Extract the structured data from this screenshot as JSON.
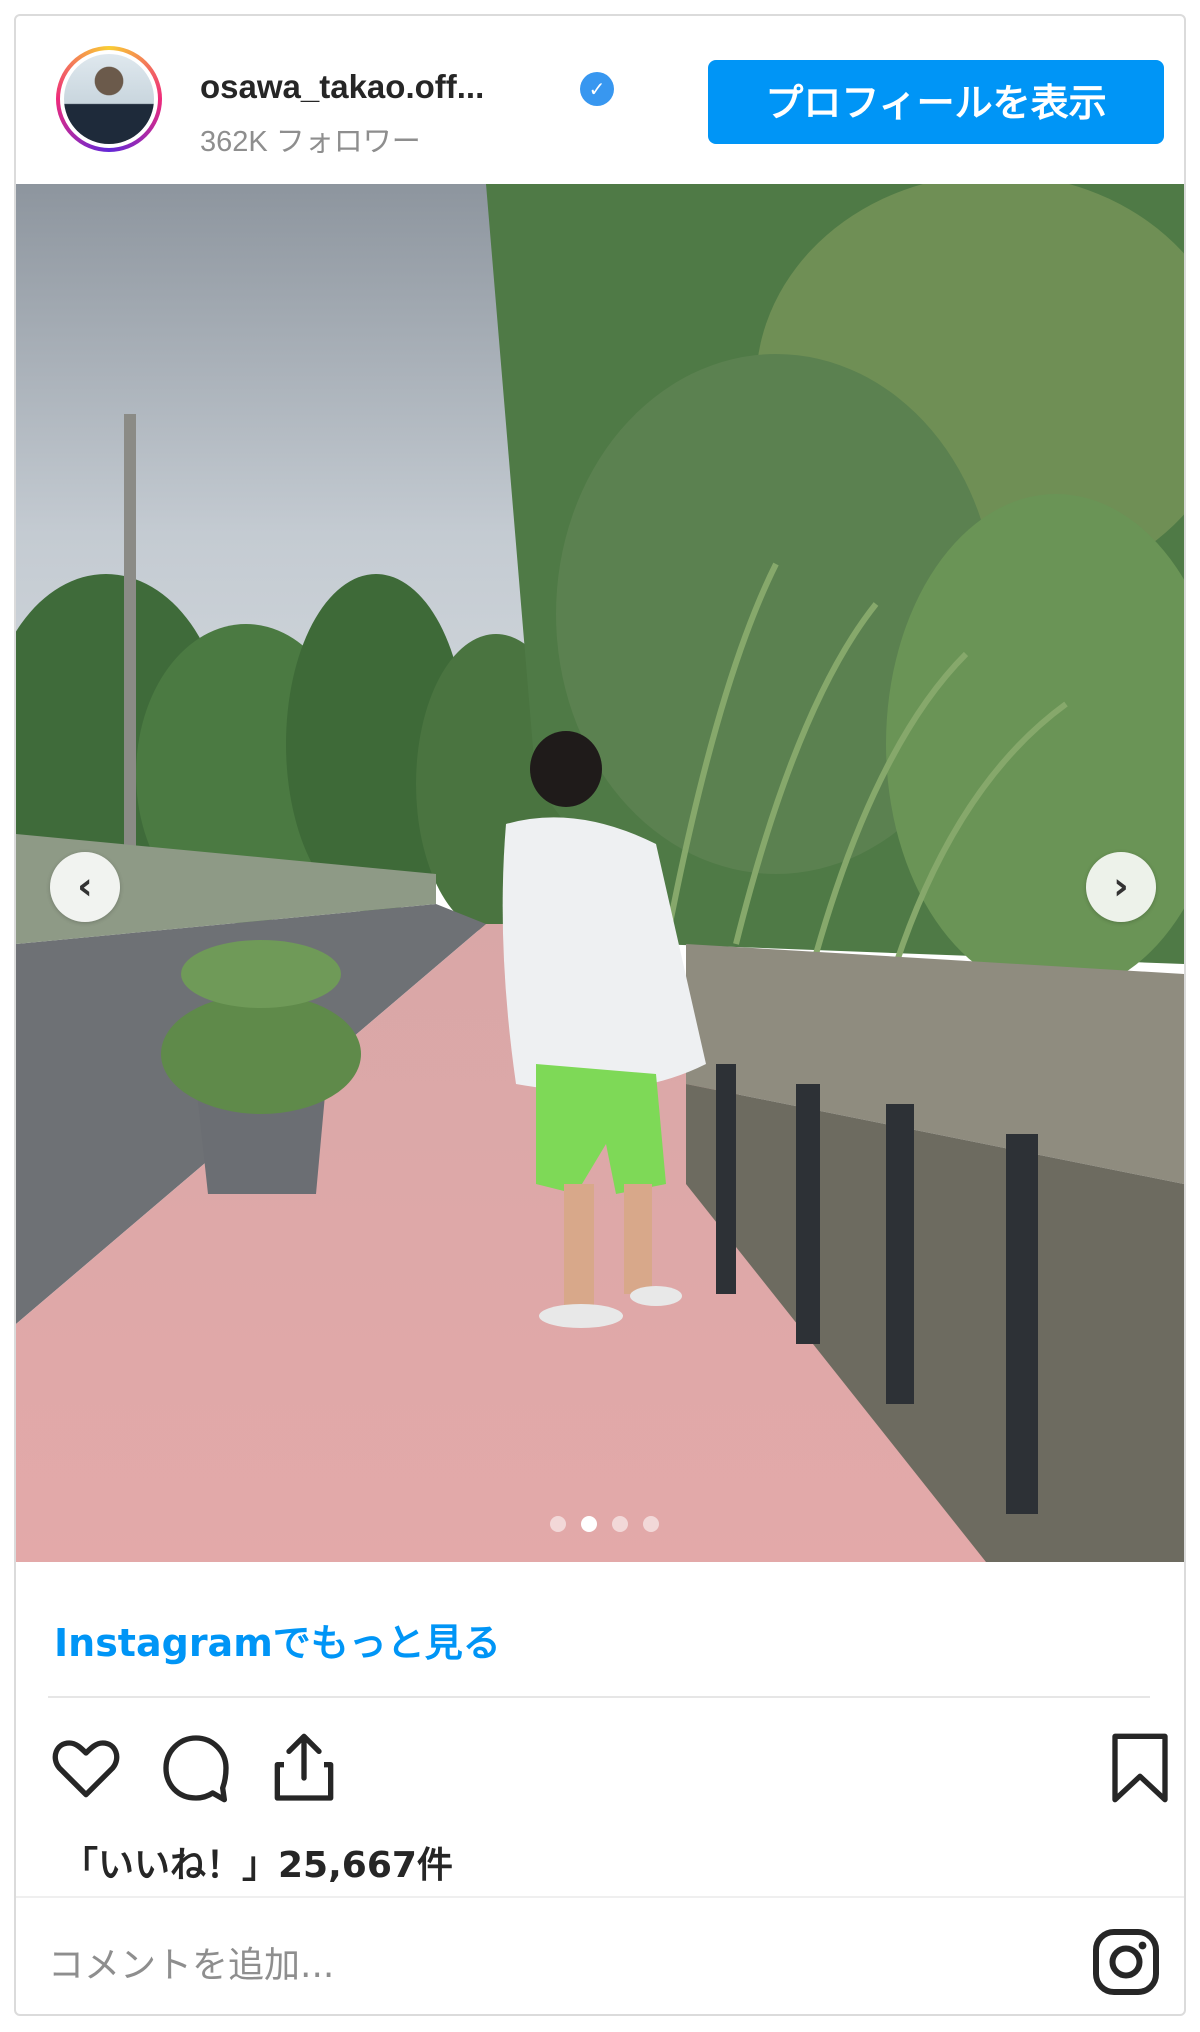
{
  "post": {
    "username": "osawa_takao.off...",
    "verified_icon": "verified-badge-icon",
    "followers": "362K フォロワー",
    "profile_button": "プロフィールを表示",
    "prev_arrow": "‹",
    "next_arrow": "›",
    "carousel": {
      "total_slides": 4,
      "active_slide": 2
    },
    "more_link": "Instagramでもっと見る",
    "likes": "「いいね！」25,667件",
    "comment_placeholder": "コメントを追加...",
    "icons": {
      "heart": "heart-icon",
      "comment": "comment-icon",
      "share": "share-icon",
      "bookmark": "bookmark-icon",
      "instagram": "instagram-logo-icon"
    }
  },
  "colors": {
    "accent": "#0095f6",
    "text": "#262626",
    "muted": "#8e8e8e",
    "border": "#dbdbdb"
  }
}
